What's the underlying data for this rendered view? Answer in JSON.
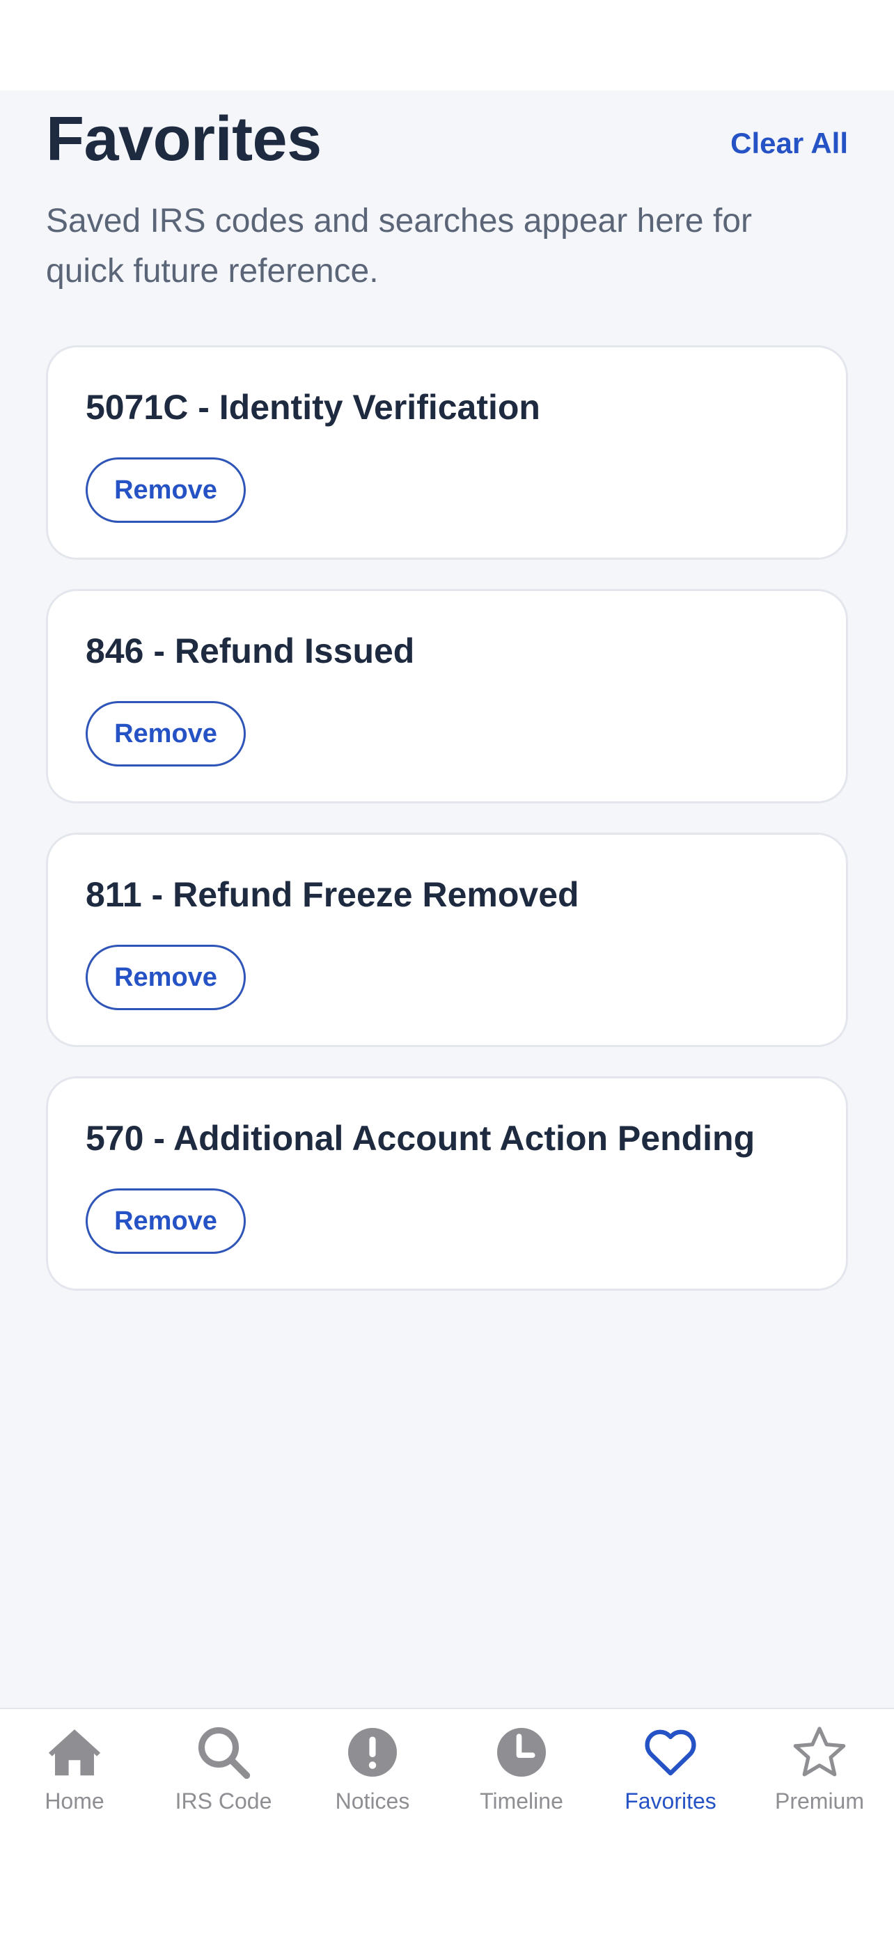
{
  "header": {
    "title": "Favorites",
    "clear_all_label": "Clear All",
    "subtitle": "Saved IRS codes and searches appear here for quick future reference."
  },
  "favorites": [
    {
      "title": "5071C - Identity Verification",
      "remove_label": "Remove"
    },
    {
      "title": "846 - Refund Issued",
      "remove_label": "Remove"
    },
    {
      "title": "811 - Refund Freeze Removed",
      "remove_label": "Remove"
    },
    {
      "title": "570 - Additional Account Action Pending",
      "remove_label": "Remove"
    }
  ],
  "tabbar": {
    "tabs": [
      {
        "label": "Home",
        "icon": "home-icon",
        "active": false
      },
      {
        "label": "IRS Code",
        "icon": "search-icon",
        "active": false
      },
      {
        "label": "Notices",
        "icon": "alert-icon",
        "active": false
      },
      {
        "label": "Timeline",
        "icon": "clock-icon",
        "active": false
      },
      {
        "label": "Favorites",
        "icon": "heart-icon",
        "active": true
      },
      {
        "label": "Premium",
        "icon": "star-icon",
        "active": false
      }
    ]
  },
  "colors": {
    "accent": "#2552c4",
    "title_text": "#1e2a3f",
    "subtitle_text": "#5b6578",
    "background": "#f4f6fa",
    "inactive_tab": "#8e8e93"
  }
}
